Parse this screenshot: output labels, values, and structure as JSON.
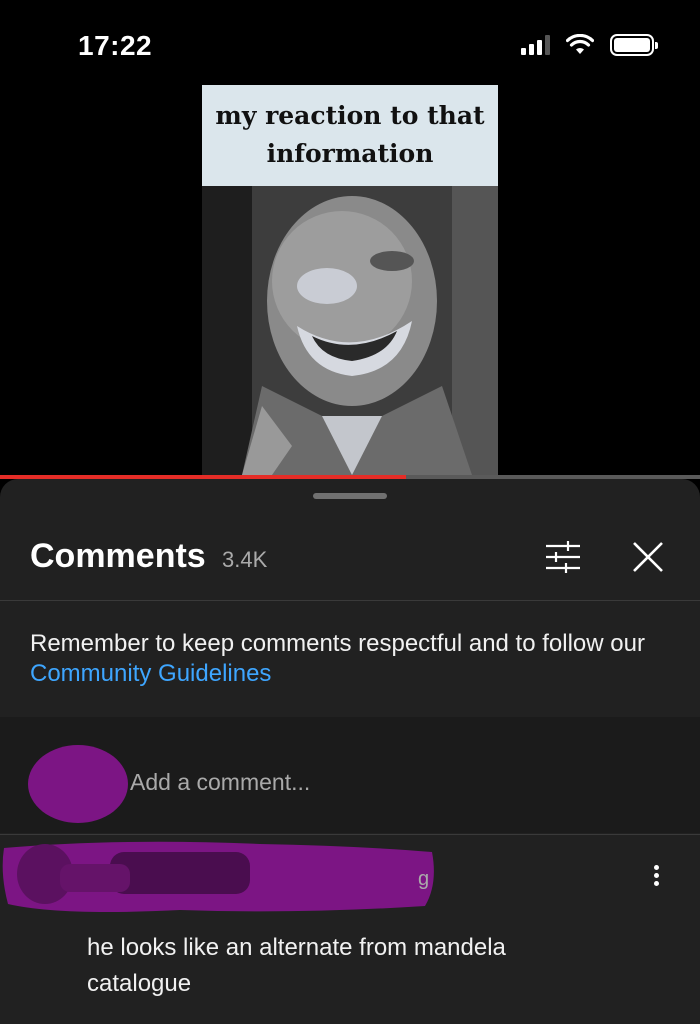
{
  "status_bar": {
    "time": "17:22",
    "icons": [
      "cellular-signal-icon",
      "wifi-icon",
      "battery-icon"
    ],
    "battery_level": 1.0
  },
  "video": {
    "meme_caption_line1": "my reaction to that",
    "meme_caption_line2": "information",
    "progress_fraction": 0.58,
    "progress_color": "#e52d27"
  },
  "comments_sheet": {
    "title": "Comments",
    "count": "3.4K",
    "filter_icon": "sliders-icon",
    "close_icon": "close-icon",
    "guidelines_text": "Remember to keep comments respectful and to follow our",
    "guidelines_link": "Community Guidelines",
    "link_color": "#3ea6ff",
    "composer_placeholder": "Add a comment...",
    "redaction_color": "#7c1584"
  },
  "comments": [
    {
      "meta_visible": "g",
      "text": "he looks like an alternate from mandela catalogue",
      "menu_icon": "more-vertical-icon"
    }
  ]
}
